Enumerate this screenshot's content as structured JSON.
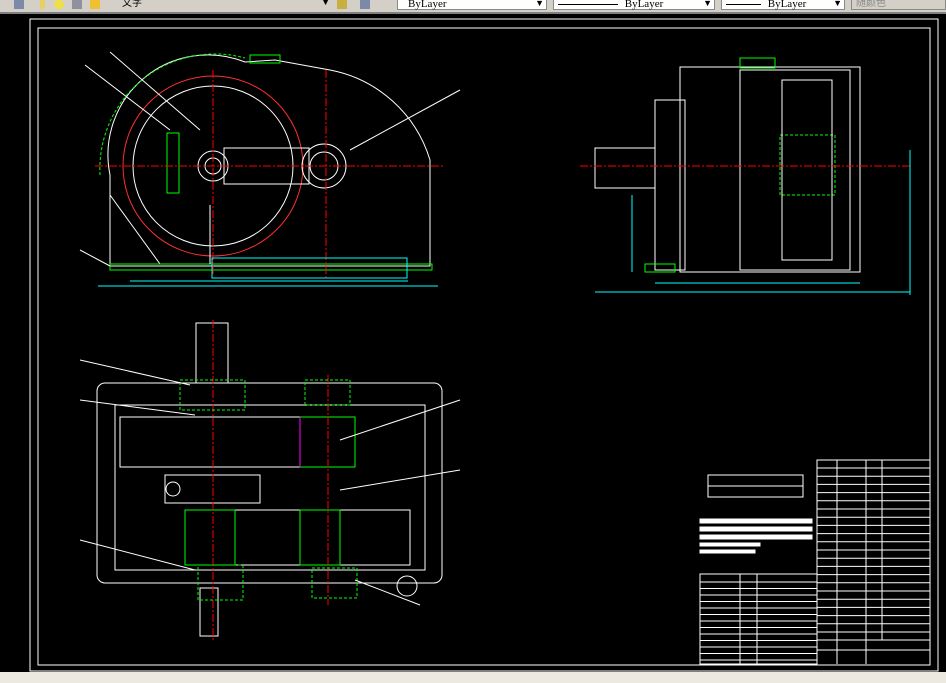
{
  "toolbar": {
    "layer_name": "文字",
    "color_value": "ByLayer",
    "linetype_value": "ByLayer",
    "lineweight_value": "ByLayer",
    "plotstyle_value": "随颜色"
  },
  "icons": [
    "layer-manager-icon",
    "bulb-icon",
    "sun-icon",
    "lock-icon",
    "color-square-icon",
    "make-current-layer-icon",
    "layer-previous-icon",
    "dropdown-arrow-icon"
  ],
  "colors": {
    "background": "#000000",
    "outline": "#ffffff",
    "centerline": "#ff0000",
    "hatch": "#00ff00",
    "dimension": "#00ffff",
    "highlight": "#ff00ff",
    "toolbar": "#d4d0c8"
  }
}
